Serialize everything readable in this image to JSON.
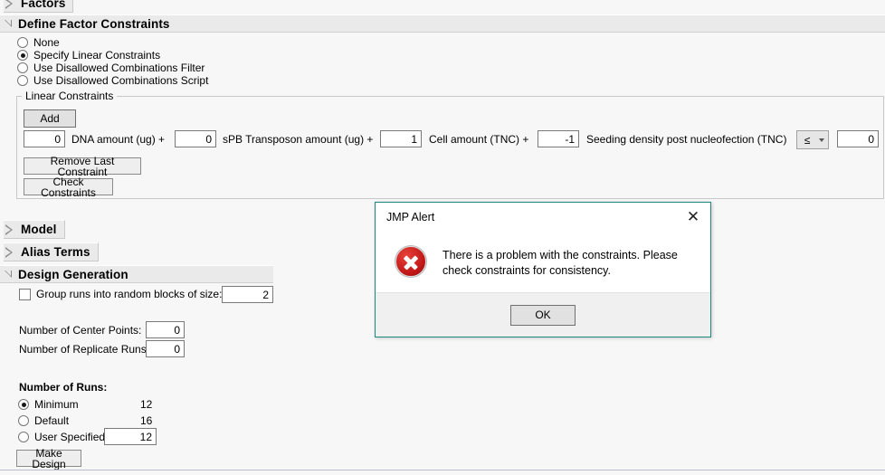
{
  "window": {
    "background": "#f7f7f7"
  },
  "sections": {
    "factors": {
      "title": "Factors",
      "state": "collapsed"
    },
    "define_factor_constraints": {
      "title": "Define Factor Constraints",
      "state": "expanded"
    },
    "model": {
      "title": "Model",
      "state": "collapsed"
    },
    "alias_terms": {
      "title": "Alias Terms",
      "state": "collapsed"
    },
    "design_generation": {
      "title": "Design Generation",
      "state": "expanded"
    }
  },
  "constraint_options": {
    "items": [
      {
        "label": "None",
        "selected": false
      },
      {
        "label": "Specify Linear Constraints",
        "selected": true
      },
      {
        "label": "Use Disallowed Combinations Filter",
        "selected": false
      },
      {
        "label": "Use Disallowed Combinations Script",
        "selected": false
      }
    ]
  },
  "linear_constraints": {
    "group_label": "Linear Constraints",
    "add_label": "Add",
    "remove_label": "Remove Last Constraint",
    "check_label": "Check Constraints",
    "terms": [
      {
        "coefficient": "0",
        "factor": "DNA amount (ug) +"
      },
      {
        "coefficient": "0",
        "factor": "sPB Transposon amount (ug) +"
      },
      {
        "coefficient": "1",
        "factor": "Cell amount (TNC) +"
      },
      {
        "coefficient": "-1",
        "factor": "Seeding density post nucleofection (TNC)"
      }
    ],
    "operator": "≤",
    "rhs": "0"
  },
  "design_generation": {
    "group_blocks": {
      "label": "Group runs into random blocks of size:",
      "checked": false,
      "value": "2"
    },
    "center_points": {
      "label": "Number of Center Points:",
      "value": "0"
    },
    "replicate_runs": {
      "label": "Number of Replicate Runs:",
      "value": "0"
    },
    "number_of_runs": {
      "title": "Number of Runs:",
      "options": [
        {
          "label": "Minimum",
          "value": "12",
          "selected": true,
          "editable": false
        },
        {
          "label": "Default",
          "value": "16",
          "selected": false,
          "editable": false
        },
        {
          "label": "User Specified",
          "value": "12",
          "selected": false,
          "editable": true
        }
      ]
    },
    "make_design_label": "Make Design"
  },
  "alert": {
    "title": "JMP Alert",
    "close_icon": "✕",
    "icon": "error-circle-icon",
    "message": "There is a problem with the constraints. Please check constraints for consistency.",
    "ok_label": "OK",
    "border_color": "#178c7c",
    "icon_color": "#c01717"
  }
}
